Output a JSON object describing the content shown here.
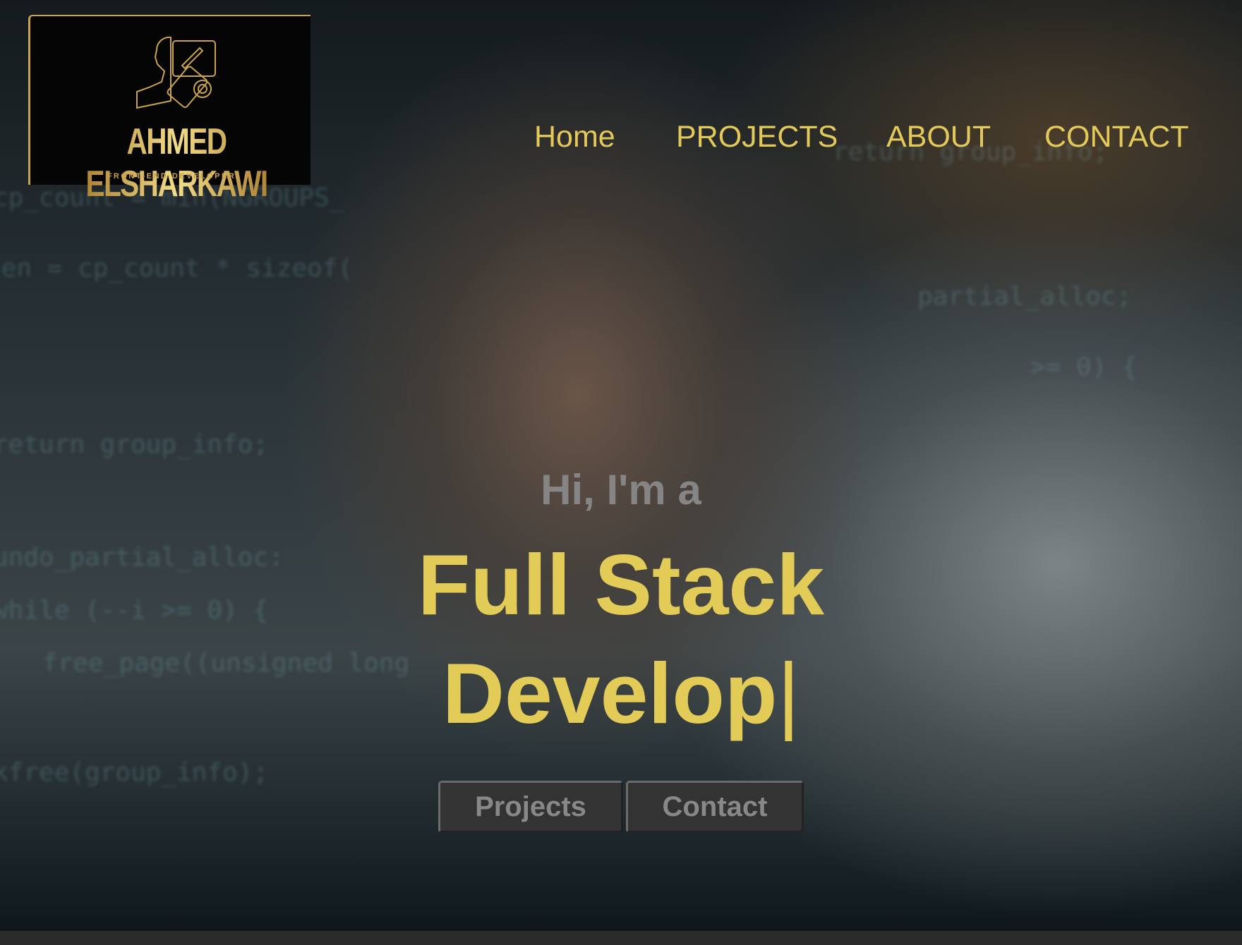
{
  "logo": {
    "name": "AHMED ELSHARKAWI",
    "subtitle": "FRONT-END DEVELOPER"
  },
  "nav": {
    "items": [
      "Home",
      "PROJECTS",
      "ABOUT",
      "CONTACT"
    ]
  },
  "hero": {
    "greeting": "Hi, I'm a",
    "title_line1": "Full Stack",
    "title_line2": "Develop",
    "cursor": "|"
  },
  "buttons": {
    "projects": "Projects",
    "contact": "Contact"
  },
  "colors": {
    "accent": "#e3cb57",
    "button_bg": "#333333",
    "greeting": "#858585"
  }
}
